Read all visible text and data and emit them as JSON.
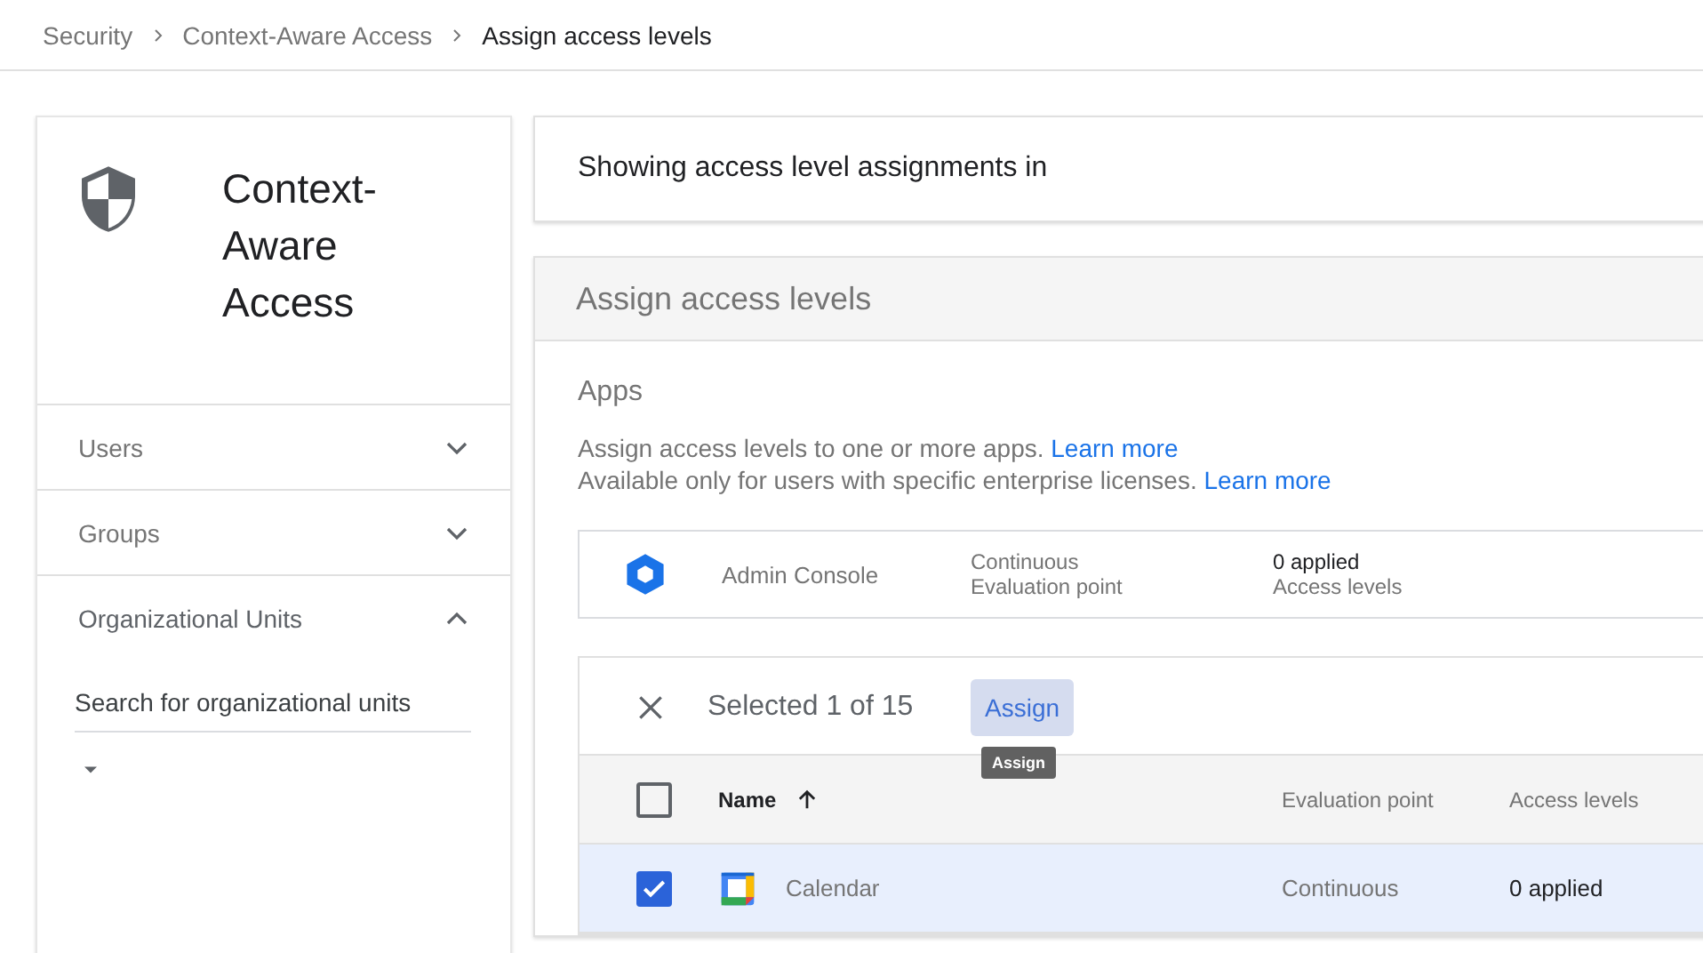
{
  "breadcrumb": [
    {
      "label": "Security",
      "current": false
    },
    {
      "label": "Context-Aware Access",
      "current": false
    },
    {
      "label": "Assign access levels",
      "current": true
    }
  ],
  "sidebar": {
    "title": "Context-Aware Access",
    "sections": [
      {
        "label": "Users",
        "expanded": false
      },
      {
        "label": "Groups",
        "expanded": false
      },
      {
        "label": "Organizational Units",
        "expanded": true,
        "search": {
          "placeholder": "Search for organizational units"
        }
      }
    ]
  },
  "showing_card": {
    "text": "Showing access level assignments in"
  },
  "assign_panel": {
    "title": "Assign access levels",
    "section_title": "Apps",
    "description": [
      {
        "text": "Assign access levels to one or more apps.",
        "link": "Learn more"
      },
      {
        "text": "Available only for users with specific enterprise licenses.",
        "link": "Learn more"
      }
    ],
    "summary": {
      "app": "Admin Console",
      "evaluation": "Continuous",
      "evaluation_label": "Evaluation point",
      "levels": "0 applied",
      "levels_label": "Access levels"
    },
    "selection_bar": {
      "text": "Selected 1 of 15",
      "button": "Assign",
      "tooltip": "Assign"
    },
    "table": {
      "columns": [
        "Name",
        "Evaluation point",
        "Access levels"
      ],
      "all_checked": false,
      "rows": [
        {
          "name": "Calendar",
          "evaluation": "Continuous",
          "levels": "0 applied",
          "selected": true
        }
      ]
    }
  }
}
